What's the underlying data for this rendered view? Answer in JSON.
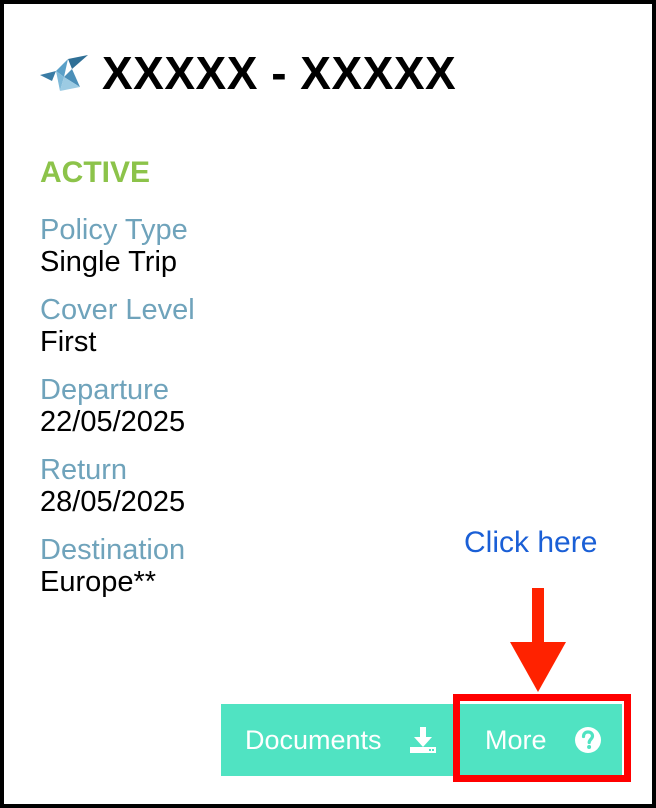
{
  "header": {
    "title": "XXXXX - XXXXX",
    "logo_icon": "origami-bird-icon"
  },
  "status": {
    "label": "ACTIVE",
    "color": "#8cc34a"
  },
  "fields": [
    {
      "label": "Policy Type",
      "value": "Single Trip"
    },
    {
      "label": "Cover Level",
      "value": "First"
    },
    {
      "label": "Departure",
      "value": "22/05/2025"
    },
    {
      "label": "Return",
      "value": "28/05/2025"
    },
    {
      "label": "Destination",
      "value": "Europe**"
    }
  ],
  "annotation": {
    "text": "Click here",
    "arrow_color": "#ff2200",
    "highlight_color": "#ff0000"
  },
  "buttons": {
    "documents": {
      "label": "Documents",
      "icon": "download-icon"
    },
    "more": {
      "label": "More",
      "icon": "question-circle-icon"
    },
    "color": "#50e3c2"
  }
}
